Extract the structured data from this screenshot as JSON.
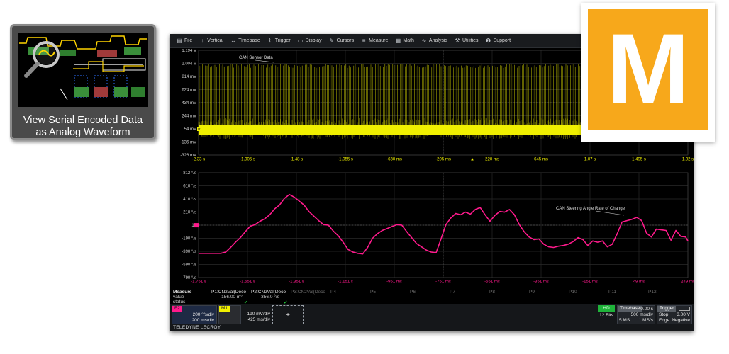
{
  "thumbnail": {
    "caption_line1": "View Serial Encoded Data",
    "caption_line2": "as Analog Waveform"
  },
  "menu": {
    "items": [
      {
        "label": "File",
        "icon": "file-icon"
      },
      {
        "label": "Vertical",
        "icon": "vertical-icon"
      },
      {
        "label": "Timebase",
        "icon": "timebase-icon"
      },
      {
        "label": "Trigger",
        "icon": "trigger-icon"
      },
      {
        "label": "Display",
        "icon": "display-icon"
      },
      {
        "label": "Cursors",
        "icon": "cursors-icon"
      },
      {
        "label": "Measure",
        "icon": "measure-icon"
      },
      {
        "label": "Math",
        "icon": "math-icon"
      },
      {
        "label": "Analysis",
        "icon": "analysis-icon"
      },
      {
        "label": "Utilities",
        "icon": "utilities-icon"
      },
      {
        "label": "Support",
        "icon": "support-icon"
      }
    ]
  },
  "chart_data": [
    {
      "type": "line",
      "annotation": "CAN Sensor Data",
      "channel_badge": "P1",
      "series_color": "#f0f000",
      "y_ticks": [
        "1.194 V",
        "1.004 V",
        "814 mV",
        "624 mV",
        "434 mV",
        "244 mV",
        "54 mV",
        "-136 mV",
        "-326 mV"
      ],
      "x_ticks": [
        "-2.33 s",
        "-1.905 s",
        "-1.48 s",
        "-1.055 s",
        "-630 ms",
        "-205 ms",
        "220 ms",
        "645 ms",
        "1.07 s",
        "1.495 s",
        "1.92 s"
      ],
      "description": "dense serial encoded waveform; baseline near 54 mV with bursts to ~1.0 V",
      "baseline_mV": 54,
      "burst_high_V": 1.0,
      "grid": true
    },
    {
      "type": "line",
      "annotation": "CAN Steering Angle Rate of Change",
      "series_color": "#ff1a8c",
      "y_ticks": [
        "812 °/s",
        "610 °/s",
        "410 °/s",
        "210 °/s",
        "10",
        "-190 °/s",
        "-390 °/s",
        "-590 °/s",
        "-790 °/s"
      ],
      "x_ticks": [
        "-1.751 s",
        "-1.551 s",
        "-1.351 s",
        "-1.151 s",
        "-951 ms",
        "-751 ms",
        "-551 ms",
        "-351 ms",
        "-151 ms",
        "49 ms",
        "249 ms"
      ],
      "x": [
        -1.751,
        -1.72,
        -1.69,
        -1.66,
        -1.64,
        -1.62,
        -1.6,
        -1.58,
        -1.56,
        -1.54,
        -1.52,
        -1.5,
        -1.48,
        -1.46,
        -1.44,
        -1.42,
        -1.4,
        -1.38,
        -1.36,
        -1.34,
        -1.32,
        -1.3,
        -1.28,
        -1.26,
        -1.24,
        -1.22,
        -1.2,
        -1.18,
        -1.16,
        -1.14,
        -1.12,
        -1.1,
        -1.08,
        -1.06,
        -1.04,
        -1.02,
        -1.0,
        -0.98,
        -0.96,
        -0.94,
        -0.92,
        -0.9,
        -0.88,
        -0.86,
        -0.84,
        -0.82,
        -0.8,
        -0.78,
        -0.76,
        -0.74,
        -0.72,
        -0.7,
        -0.68,
        -0.66,
        -0.64,
        -0.62,
        -0.6,
        -0.58,
        -0.56,
        -0.54,
        -0.52,
        -0.5,
        -0.48,
        -0.46,
        -0.44,
        -0.42,
        -0.4,
        -0.38,
        -0.36,
        -0.34,
        -0.32,
        -0.3,
        -0.28,
        -0.26,
        -0.24,
        -0.22,
        -0.2,
        -0.18,
        -0.16,
        -0.14,
        -0.12,
        -0.1,
        -0.08,
        -0.06,
        -0.04,
        -0.02,
        0.0,
        0.02,
        0.04,
        0.06,
        0.08,
        0.1,
        0.12,
        0.14,
        0.16,
        0.18,
        0.2,
        0.22,
        0.24,
        0.249
      ],
      "y": [
        -420,
        -420,
        -420,
        -420,
        -400,
        -330,
        -250,
        -180,
        -90,
        -5,
        20,
        70,
        110,
        170,
        260,
        320,
        420,
        480,
        440,
        380,
        320,
        220,
        150,
        80,
        20,
        10,
        -80,
        -150,
        -250,
        -360,
        -400,
        -420,
        -430,
        -330,
        -190,
        -120,
        -70,
        -40,
        -10,
        20,
        10,
        -90,
        -180,
        -270,
        -320,
        -370,
        -400,
        -410,
        -200,
        20,
        120,
        190,
        170,
        210,
        180,
        250,
        280,
        170,
        70,
        160,
        220,
        210,
        250,
        170,
        20,
        -90,
        -170,
        -210,
        -200,
        -280,
        -320,
        -330,
        -310,
        -300,
        -280,
        -240,
        -180,
        -210,
        -300,
        -230,
        -250,
        -230,
        -320,
        -280,
        -120,
        60,
        80,
        100,
        130,
        80,
        -110,
        -170,
        -50,
        -60,
        -70,
        -220,
        -70,
        -160,
        -170,
        -230
      ],
      "ylim": [
        -790,
        812
      ],
      "grid": true
    }
  ],
  "measure": {
    "header": "Measure",
    "row_value": "value",
    "row_status": "status",
    "params": [
      {
        "label": "P1:CN2Val(Deco",
        "value": "-156.00 m°",
        "status": "✔"
      },
      {
        "label": "P2:CN2Val(Deco",
        "value": "-356.0 °/s",
        "status": "✔"
      },
      {
        "label": "P3:CN2Val(Deco",
        "value": "",
        "status": ""
      },
      {
        "label": "P4",
        "value": "",
        "status": ""
      },
      {
        "label": "P5",
        "value": "",
        "status": ""
      },
      {
        "label": "P6",
        "value": "",
        "status": ""
      },
      {
        "label": "P7",
        "value": "",
        "status": ""
      },
      {
        "label": "P8",
        "value": "",
        "status": ""
      },
      {
        "label": "P9",
        "value": "",
        "status": ""
      },
      {
        "label": "P10",
        "value": "",
        "status": ""
      },
      {
        "label": "P11",
        "value": "",
        "status": ""
      },
      {
        "label": "P12",
        "value": "",
        "status": ""
      }
    ]
  },
  "descriptors": {
    "trace_f": {
      "label": "F2",
      "scale": "200 °/s/div",
      "time": "200 ms/div",
      "color": "#ff1a8c"
    },
    "trace_m": {
      "label": "M1",
      "scale": "190 mV/div",
      "time": "425 ms/div",
      "color": "#f0f000"
    },
    "add_label": "+",
    "hd_badge": "HD",
    "bits": "12 Bits",
    "timebase": {
      "label": "Timebase",
      "offset": "0.00 s",
      "per_div": "500 ms/div",
      "samples": "5 MS",
      "rate": "1 MS/s"
    },
    "trigger": {
      "label": "Trigger",
      "mode": "Stop",
      "level": "3.00 V",
      "type": "Edge",
      "slope": "Negative"
    }
  },
  "brand": {
    "name": "TELEDYNE LECROY"
  },
  "logo": {
    "letter": "M",
    "color": "#f7a81b"
  }
}
